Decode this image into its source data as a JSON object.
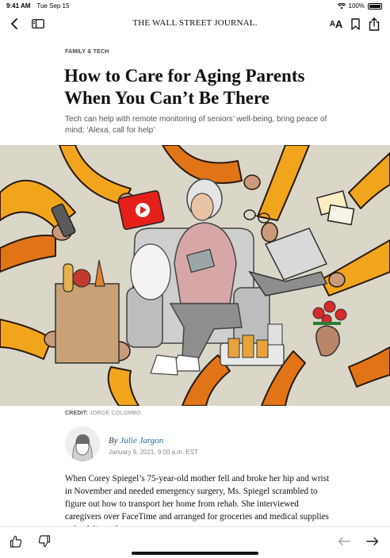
{
  "status_bar": {
    "time": "9:41 AM",
    "date": "Tue Sep 15",
    "battery": "100%"
  },
  "toolbar": {
    "masthead": "THE WALL STREET JOURNAL.",
    "text_size_large": "A",
    "text_size_small": "A"
  },
  "article": {
    "section": "FAMILY & TECH",
    "headline": "How to Care for Aging Parents When You Can’t Be There",
    "dek": "Tech can help with remote monitoring of seniors’ well-being, bring peace of mind; ‘Alexa, call for help’",
    "credit_label": "CREDIT:",
    "credit_name": "JORGE COLOMBO",
    "byline_prefix": "By",
    "author": "Julie Jargon",
    "date": "January 9, 2021, 9:00 a.m. EST",
    "body": "When Corey Spiegel’s 75-year-old mother fell and broke her hip and wrist in November and needed emergency surgery, Ms. Spiegel scrambled to figure out how to transport her home from rehab. She interviewed caregivers over FaceTime and arranged for groceries and medical supplies to be delivered."
  },
  "colors": {
    "link": "#1a6aa0",
    "orange_arm": "#f0a51c",
    "dark_orange_arm": "#e07416",
    "tablet_red": "#e5201b"
  },
  "icons": [
    "back-icon",
    "sidebar-icon",
    "text-size-icon",
    "bookmark-icon",
    "share-icon",
    "thumbs-up-icon",
    "thumbs-down-icon",
    "previous-arrow-icon",
    "next-arrow-icon",
    "wifi-icon",
    "battery-icon"
  ]
}
